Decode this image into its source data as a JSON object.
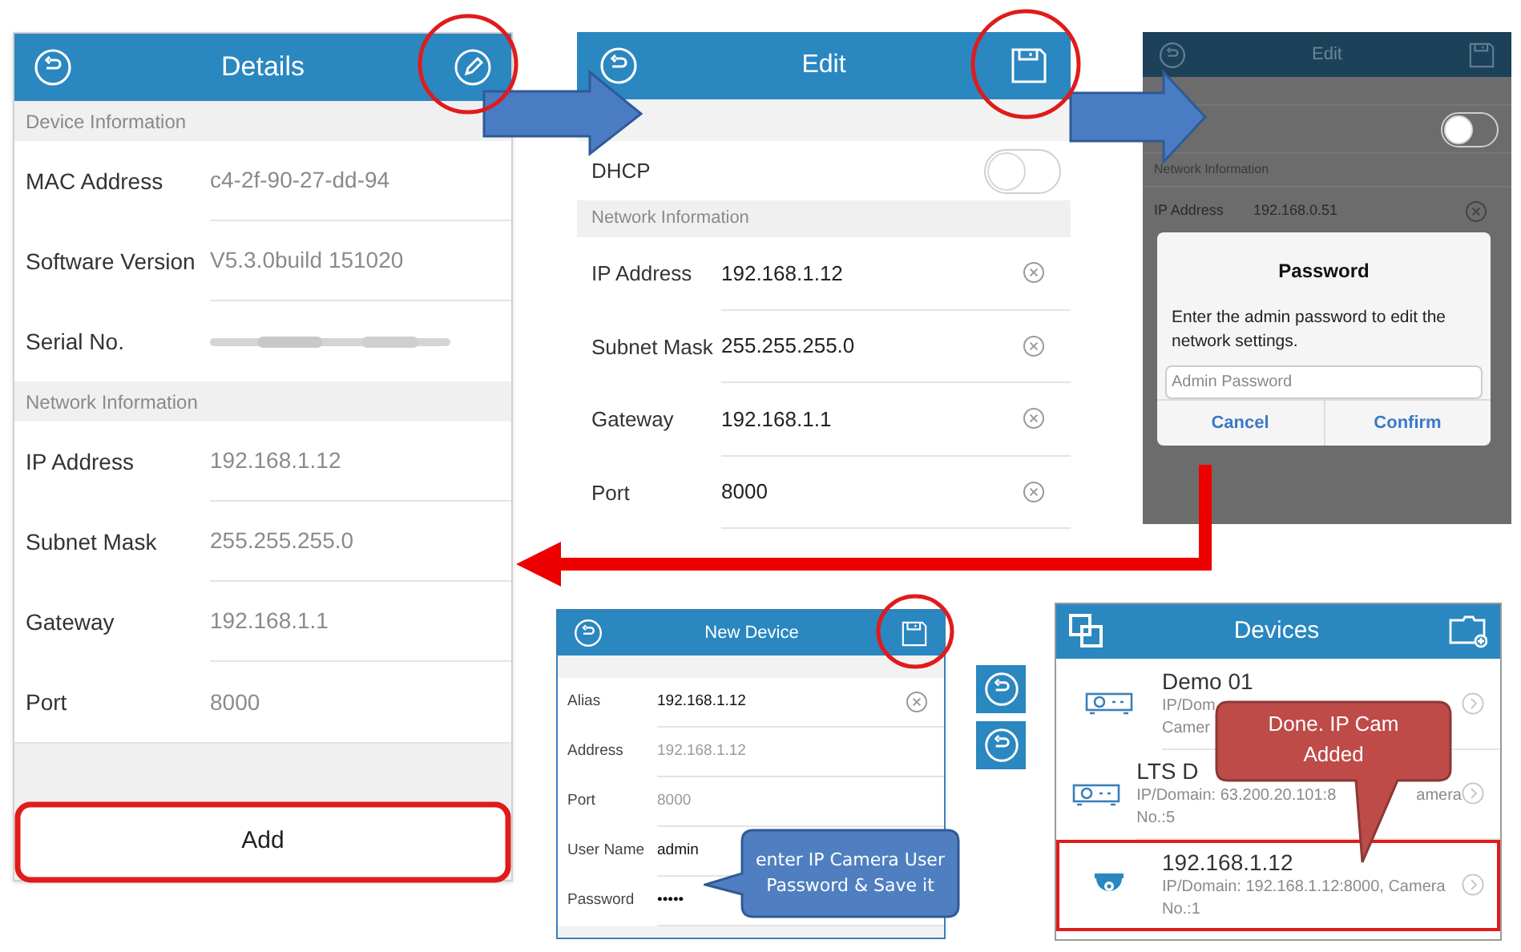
{
  "details": {
    "title": "Details",
    "sections": [
      {
        "heading": "Device Information",
        "rows": [
          {
            "label": "MAC Address",
            "value": "c4-2f-90-27-dd-94",
            "kind": "text"
          },
          {
            "label": "Software Version",
            "value": "V5.3.0build 151020",
            "kind": "text"
          },
          {
            "label": "Serial No.",
            "kind": "blurred"
          }
        ]
      },
      {
        "heading": "Network Information",
        "rows": [
          {
            "label": "IP Address",
            "value": "192.168.1.12",
            "kind": "text"
          },
          {
            "label": "Subnet Mask",
            "value": "255.255.255.0",
            "kind": "text"
          },
          {
            "label": "Gateway",
            "value": "192.168.1.1",
            "kind": "text"
          },
          {
            "label": "Port",
            "value": "8000",
            "kind": "text"
          }
        ]
      }
    ],
    "button": "Add"
  },
  "edit": {
    "title": "Edit",
    "dhcp": {
      "label": "DHCP",
      "on": false
    },
    "section_heading": "Network Information",
    "rows": [
      {
        "label": "IP Address",
        "value": "192.168.1.12"
      },
      {
        "label": "Subnet Mask",
        "value": "255.255.255.0"
      },
      {
        "label": "Gateway",
        "value": "192.168.1.1"
      },
      {
        "label": "Port",
        "value": "8000"
      }
    ]
  },
  "password_screen": {
    "title": "Edit",
    "dhcp_on": false,
    "section_heading": "Network Information",
    "row": {
      "label": "IP Address",
      "value": "192.168.0.51"
    },
    "dialog": {
      "title": "Password",
      "message": "Enter the admin password to edit the network settings.",
      "placeholder": "Admin Password",
      "buttons": [
        "Cancel",
        "Confirm"
      ]
    }
  },
  "new_device": {
    "title": "New Device",
    "rows": [
      {
        "label": "Alias",
        "value": "192.168.1.12",
        "kind": "clearable"
      },
      {
        "label": "Address",
        "value": "192.168.1.12",
        "kind": "hint"
      },
      {
        "label": "Port",
        "value": "8000",
        "kind": "hint"
      },
      {
        "label": "User Name",
        "value": "admin",
        "kind": "text"
      },
      {
        "label": "Password",
        "value": "•••••",
        "kind": "text"
      }
    ]
  },
  "devices": {
    "title": "Devices",
    "items": [
      {
        "kind": "recorder",
        "title": "Demo 01",
        "lines": [
          [
            "IP/Dom"
          ],
          [
            "Camer"
          ]
        ],
        "highlighted": false
      },
      {
        "kind": "recorder",
        "title": "LTS D",
        "lines": [
          [
            "IP/Domain: 63.200.20.101:8",
            "amera"
          ],
          [
            "No.:5"
          ]
        ],
        "highlighted": false
      },
      {
        "kind": "camera",
        "title": "192.168.1.12",
        "lines": [
          [
            "IP/Domain: 192.168.1.12:8000, Camera"
          ],
          [
            "No.:1"
          ]
        ],
        "highlighted": true
      }
    ]
  },
  "callouts": [
    {
      "kind": "info",
      "text": "enter IP Camera User Password & Save it"
    },
    {
      "kind": "done",
      "text": "Done. IP Cam Added"
    }
  ]
}
